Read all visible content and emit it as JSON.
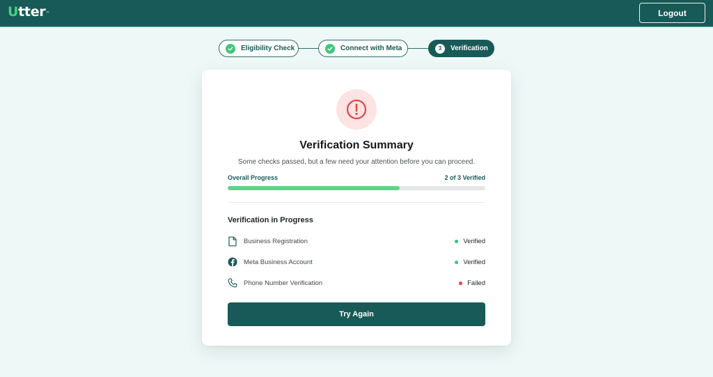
{
  "header": {
    "logo_first": "U",
    "logo_rest": "tter",
    "logo_tm": "™",
    "logout_label": "Logout"
  },
  "stepper": {
    "steps": [
      {
        "label": "Eligibility Check",
        "state": "completed",
        "icon": "check-icon"
      },
      {
        "label": "Connect with Meta",
        "state": "completed",
        "icon": "check-icon"
      },
      {
        "label": "Verification",
        "state": "active",
        "number": "3"
      }
    ]
  },
  "card": {
    "icon": "alert-icon",
    "title": "Verification Summary",
    "subtitle": "Some checks passed, but a few need your attention before you can proceed.",
    "progress": {
      "label": "Overall Progress",
      "count_text": "2 of 3 Verified",
      "fraction": 0.667
    },
    "section_title": "Verification in Progress",
    "items": [
      {
        "label": "Business Registration",
        "icon": "document-icon",
        "status": "Verified",
        "status_color": "#3ec46d"
      },
      {
        "label": "Meta Business Account",
        "icon": "facebook-icon",
        "status": "Verified",
        "status_color": "#3ec46d"
      },
      {
        "label": "Phone Number Verification",
        "icon": "phone-icon",
        "status": "Failed",
        "status_color": "#e0464a"
      }
    ],
    "button_label": "Try Again"
  },
  "colors": {
    "brand": "#175a57",
    "accent_green": "#49d17e",
    "progress_fill": "#5fd38b",
    "alert_red": "#e0464a",
    "background": "#eef8f7"
  }
}
